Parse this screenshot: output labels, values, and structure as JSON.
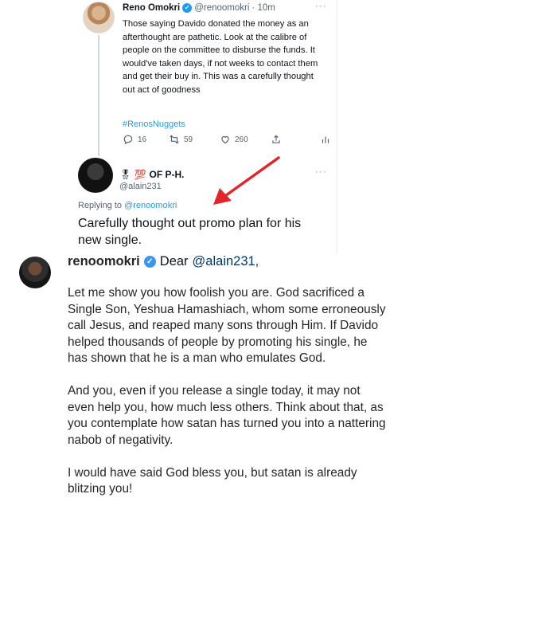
{
  "tweet": {
    "author_name": "Reno Omokri",
    "author_handle": "@renoomokri",
    "time": "· 10m",
    "text": "Those saying Davido donated the money as an afterthought are pathetic. Look at the calibre of people on the committee to disburse the funds. It would've taken days, if not weeks to contact them and get their buy in. This was a carefully thought out act of goodness",
    "hashtag": "#RenosNuggets",
    "replies": "16",
    "retweets": "59",
    "likes": "260",
    "more": "···"
  },
  "reply": {
    "author_name": "OF P-H.",
    "author_prefix": "🎖 💯",
    "author_handle": "@alain231",
    "replying_label": "Replying to",
    "replying_to": "@renoomokri",
    "text": "Carefully thought out promo plan for his new single.",
    "more": "···"
  },
  "comment": {
    "username": "renoomokri",
    "greeting": "Dear",
    "mention": "@alain231,",
    "paragraphs": [
      "Let me show you how foolish you are. God sacrificed a Single Son, Yeshua Hamashiach, whom some erroneously call Jesus, and reaped many sons through Him. If Davido helped thousands of people by promoting his single, he has shown that he is a man who emulates God.",
      "And you, even if you release a single today, it may not even help you, how much less others. Think about that, as you contemplate how satan has turned you into a nattering nabob of negativity.",
      "I would have said God bless you, but satan is already blitzing you!"
    ]
  },
  "icons": {
    "verified": "✓"
  },
  "colors": {
    "twitter_blue": "#1d9bf0",
    "arrow_red": "#e0262b",
    "instagram_verified": "#3897f0"
  }
}
